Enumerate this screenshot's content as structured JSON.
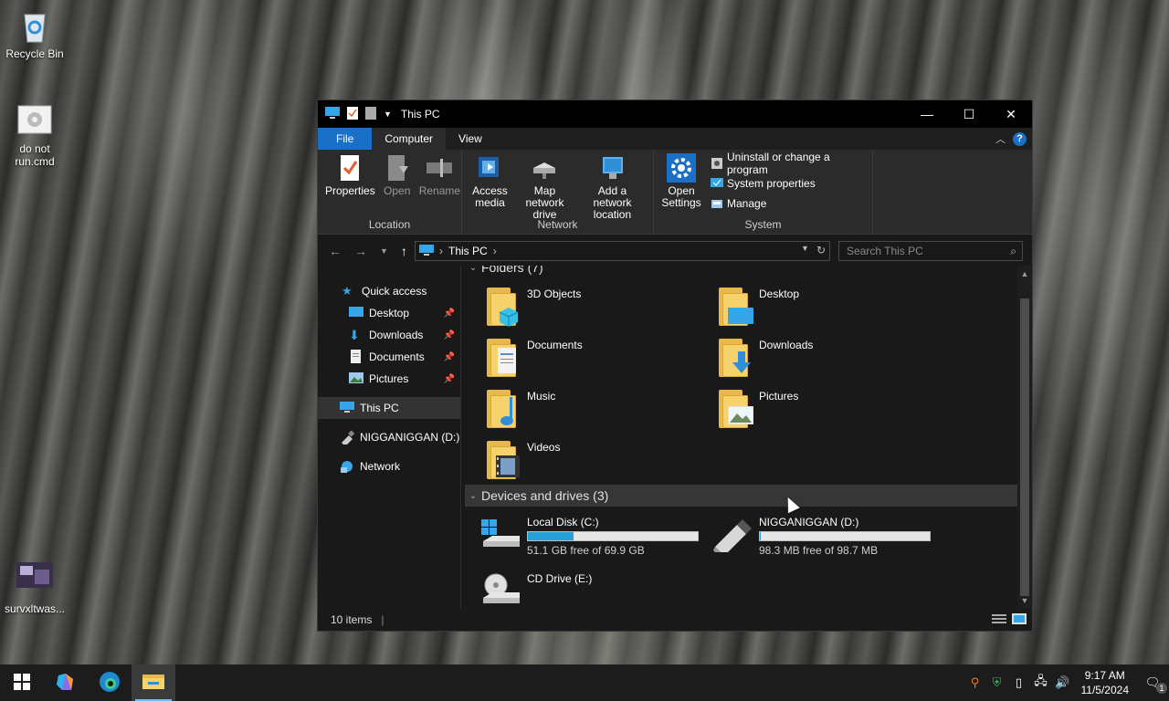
{
  "desktop": {
    "icons": [
      {
        "label": "Recycle Bin",
        "icon": "recycle-bin-icon"
      },
      {
        "label": "do not run.cmd",
        "icon": "cmd-file-icon"
      },
      {
        "label": "survxltwas...",
        "icon": "image-file-icon"
      }
    ]
  },
  "window": {
    "title": "This PC",
    "controls": {
      "minimize": "—",
      "maximize": "☐",
      "close": "✕"
    },
    "ribbon_tabs": [
      "File",
      "Computer",
      "View"
    ],
    "ribbon": {
      "location": {
        "label": "Location",
        "buttons": [
          "Properties",
          "Open",
          "Rename"
        ]
      },
      "network": {
        "label": "Network",
        "buttons": [
          "Access media",
          "Map network drive",
          "Add a network location"
        ]
      },
      "system": {
        "label": "System",
        "open_settings": "Open Settings",
        "items": [
          "Uninstall or change a program",
          "System properties",
          "Manage"
        ]
      }
    },
    "address": {
      "crumb": "This PC",
      "search_placeholder": "Search This PC"
    },
    "nav_pane": {
      "quick_access": "Quick access",
      "quick_items": [
        "Desktop",
        "Downloads",
        "Documents",
        "Pictures"
      ],
      "this_pc": "This PC",
      "drive_d": "NIGGANIGGAN (D:)",
      "network": "Network"
    },
    "content": {
      "folders_header": "Folders (7)",
      "folders": [
        "3D Objects",
        "Desktop",
        "Documents",
        "Downloads",
        "Music",
        "Pictures",
        "Videos"
      ],
      "devices_header": "Devices and drives (3)",
      "drives": [
        {
          "name": "Local Disk (C:)",
          "free": "51.1 GB free of 69.9 GB",
          "used_fraction": 0.27
        },
        {
          "name": "NIGGANIGGAN (D:)",
          "free": "98.3 MB free of 98.7 MB",
          "used_fraction": 0.004
        },
        {
          "name": "CD Drive (E:)"
        }
      ]
    },
    "status": {
      "items": "10 items"
    }
  },
  "taskbar": {
    "time": "9:17 AM",
    "date": "11/5/2024",
    "notification_count": "1"
  },
  "colors": {
    "accent": "#1a6fc7",
    "progress": "#26a0da",
    "folder": "#f6d26d"
  }
}
